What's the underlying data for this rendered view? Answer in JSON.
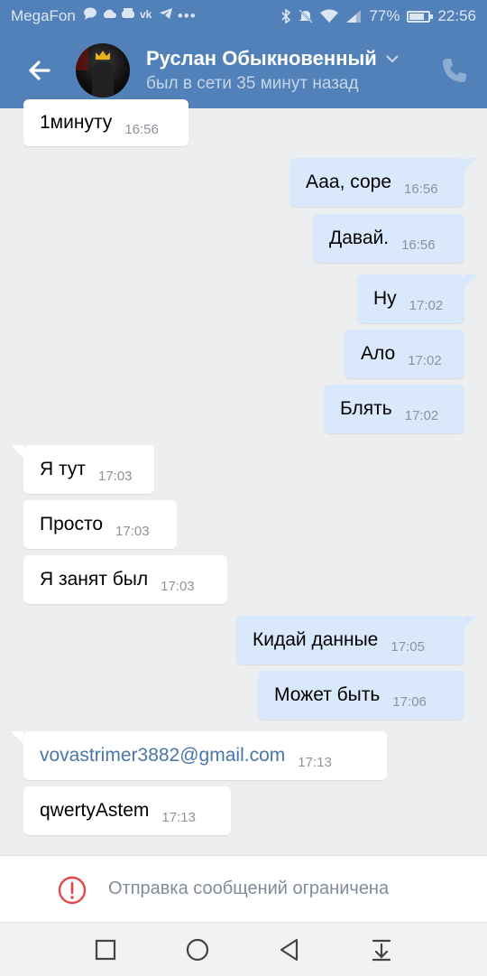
{
  "status_bar": {
    "carrier": "MegaFon",
    "battery": "77%",
    "battery_level": 0.77,
    "time": "22:56"
  },
  "header": {
    "contact_name": "Руслан Обыкновенный",
    "last_seen": "был в сети 35 минут назад"
  },
  "messages": [
    {
      "text": "1минуту",
      "time": "16:56",
      "direction": "in"
    },
    {
      "text": "Ааа, соре",
      "time": "16:56",
      "direction": "out"
    },
    {
      "text": "Давай.",
      "time": "16:56",
      "direction": "out"
    },
    {
      "text": "Ну",
      "time": "17:02",
      "direction": "out"
    },
    {
      "text": "Ало",
      "time": "17:02",
      "direction": "out"
    },
    {
      "text": "Блять",
      "time": "17:02",
      "direction": "out"
    },
    {
      "text": "Я тут",
      "time": "17:03",
      "direction": "in"
    },
    {
      "text": "Просто",
      "time": "17:03",
      "direction": "in"
    },
    {
      "text": "Я занят был",
      "time": "17:03",
      "direction": "in"
    },
    {
      "text": "Кидай данные",
      "time": "17:05",
      "direction": "out"
    },
    {
      "text": "Может быть",
      "time": "17:06",
      "direction": "out"
    },
    {
      "text": "vovastrimer3882@gmail.com",
      "time": "17:13",
      "direction": "in"
    },
    {
      "text": "qwertyAstem",
      "time": "17:13",
      "direction": "in"
    }
  ],
  "restriction": {
    "text": "Отправка сообщений ограничена"
  },
  "colors": {
    "header": "#5181b8",
    "background": "#edeef0",
    "incoming": "#ffffff",
    "outgoing": "#d9e8fa",
    "link": "#4a76a8",
    "alert": "#e64646"
  }
}
